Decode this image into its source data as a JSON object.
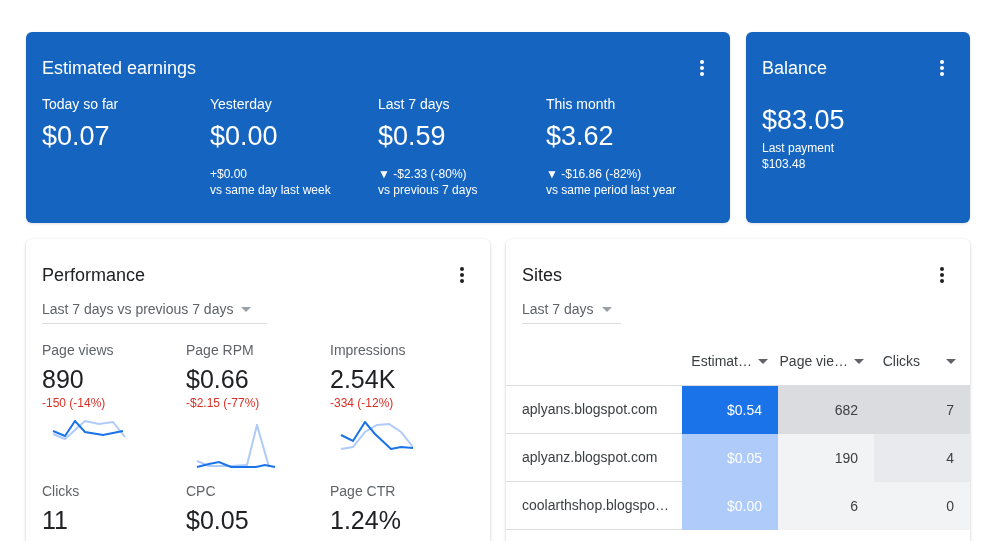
{
  "earnings": {
    "title": "Estimated earnings",
    "stats": [
      {
        "label": "Today so far",
        "value": "$0.07"
      },
      {
        "label": "Yesterday",
        "value": "$0.00",
        "change": "+$0.00",
        "comparison": "vs same day last week"
      },
      {
        "label": "Last 7 days",
        "value": "$0.59",
        "change": "▼ -$2.33 (-80%)",
        "comparison": "vs previous 7 days"
      },
      {
        "label": "This month",
        "value": "$3.62",
        "change": "▼ -$16.86 (-82%)",
        "comparison": "vs same period last year"
      }
    ]
  },
  "balance": {
    "title": "Balance",
    "value": "$83.05",
    "note": "Last payment",
    "note_value": "$103.48"
  },
  "performance": {
    "title": "Performance",
    "range": "Last 7 days vs previous 7 days",
    "metrics": [
      {
        "label": "Page views",
        "value": "890",
        "change": "-150 (-14%)",
        "kind": "sparkline"
      },
      {
        "label": "Page RPM",
        "value": "$0.66",
        "change": "-$2.15 (-77%)",
        "kind": "sparkline"
      },
      {
        "label": "Impressions",
        "value": "2.54K",
        "change": "-334 (-12%)",
        "kind": "sparkline"
      },
      {
        "label": "Clicks",
        "value": "11",
        "kind": "plain"
      },
      {
        "label": "CPC",
        "value": "$0.05",
        "kind": "plain"
      },
      {
        "label": "Page CTR",
        "value": "1.24%",
        "kind": "plain"
      }
    ]
  },
  "sites": {
    "title": "Sites",
    "range": "Last 7 days",
    "columns": [
      "Estimat…",
      "Page vie…",
      "Clicks"
    ],
    "rows": [
      {
        "site": "aplyans.blogspot.com",
        "cells": [
          {
            "text": "$0.54",
            "color": "#1a73e8"
          },
          {
            "text": "682",
            "color": "#dadce0"
          },
          {
            "text": "7",
            "color": "#dadce0"
          }
        ]
      },
      {
        "site": "aplyanz.blogspot.com",
        "cells": [
          {
            "text": "$0.05",
            "color": "#aecbfa"
          },
          {
            "text": "190",
            "color": "#f1f3f4"
          },
          {
            "text": "4",
            "color": "#e8eaed"
          }
        ]
      },
      {
        "site": "coolarthshop.blogspo…",
        "cells": [
          {
            "text": "$0.00",
            "color": "#aecbfa"
          },
          {
            "text": "6",
            "color": "#f1f3f4"
          },
          {
            "text": "0",
            "color": "#f1f3f4"
          }
        ]
      }
    ]
  }
}
